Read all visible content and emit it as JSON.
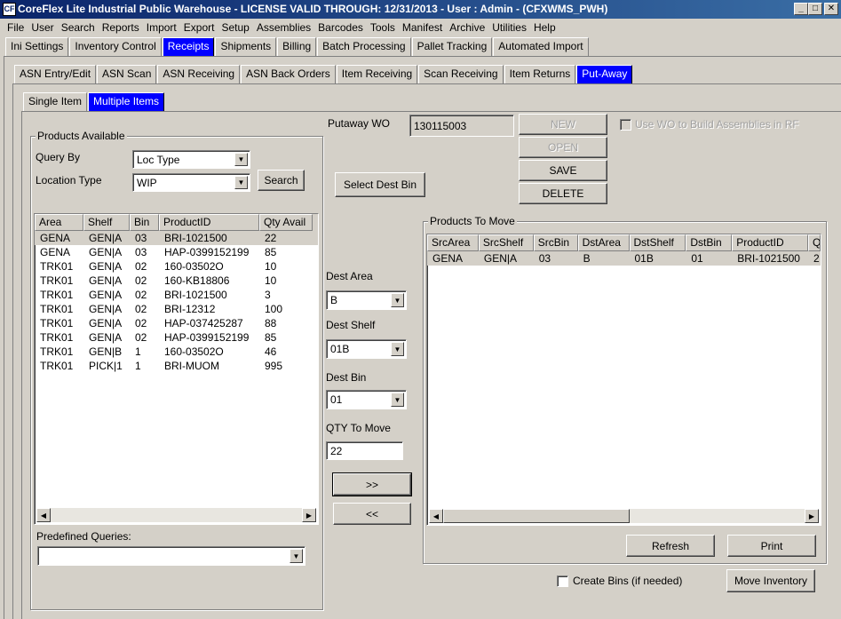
{
  "window": {
    "title": "CoreFlex Lite Industrial Public Warehouse - LICENSE VALID THROUGH: 12/31/2013 - User : Admin - (CFXWMS_PWH)",
    "minimize": "_",
    "maximize": "□",
    "close": "✕"
  },
  "menu": [
    "File",
    "User",
    "Search",
    "Reports",
    "Import",
    "Export",
    "Setup",
    "Assemblies",
    "Barcodes",
    "Tools",
    "Manifest",
    "Archive",
    "Utilities",
    "Help"
  ],
  "tabs1": [
    "Ini Settings",
    "Inventory Control",
    "Receipts",
    "Shipments",
    "Billing",
    "Batch Processing",
    "Pallet Tracking",
    "Automated Import"
  ],
  "tabs2": [
    "ASN Entry/Edit",
    "ASN Scan",
    "ASN Receiving",
    "ASN Back Orders",
    "Item Receiving",
    "Scan Receiving",
    "Item Returns",
    "Put-Away"
  ],
  "tabs3": [
    "Single Item",
    "Multiple Items"
  ],
  "products_available": {
    "title": "Products Available",
    "query_by_label": "Query By",
    "query_by_value": "Loc Type",
    "location_type_label": "Location Type",
    "location_type_value": "WIP",
    "search_button": "Search",
    "columns": [
      "Area",
      "Shelf",
      "Bin",
      "ProductID",
      "Qty Avail"
    ],
    "rows": [
      [
        "GENA",
        "GEN|A",
        "03",
        "BRI-1021500",
        "22"
      ],
      [
        "GENA",
        "GEN|A",
        "03",
        "HAP-0399152199",
        "85"
      ],
      [
        "TRK01",
        "GEN|A",
        "02",
        "160-03502O",
        "10"
      ],
      [
        "TRK01",
        "GEN|A",
        "02",
        "160-KB18806",
        "10"
      ],
      [
        "TRK01",
        "GEN|A",
        "02",
        "BRI-1021500",
        "3"
      ],
      [
        "TRK01",
        "GEN|A",
        "02",
        "BRI-12312",
        "100"
      ],
      [
        "TRK01",
        "GEN|A",
        "02",
        "HAP-037425287",
        "88"
      ],
      [
        "TRK01",
        "GEN|A",
        "02",
        "HAP-0399152199",
        "85"
      ],
      [
        "TRK01",
        "GEN|B",
        "1",
        "160-03502O",
        "46"
      ],
      [
        "TRK01",
        "PICK|1",
        "1",
        "BRI-MUOM",
        "995"
      ]
    ],
    "predefined_label": "Predefined Queries:",
    "predefined_value": ""
  },
  "putaway": {
    "label": "Putaway WO",
    "value": "130115003"
  },
  "buttons": {
    "new": "NEW",
    "open": "OPEN",
    "save": "SAVE",
    "delete": "DELETE",
    "select_dest_bin": "Select Dest Bin",
    "move_right": ">>",
    "move_left": "<<",
    "refresh": "Refresh",
    "print": "Print",
    "move_inventory": "Move Inventory"
  },
  "use_wo_label": "Use WO to Build Assemblies in RF",
  "dest": {
    "area_label": "Dest Area",
    "area_value": "B",
    "shelf_label": "Dest Shelf",
    "shelf_value": "01B",
    "bin_label": "Dest Bin",
    "bin_value": "01",
    "qty_label": "QTY To Move",
    "qty_value": "22"
  },
  "products_to_move": {
    "title": "Products To Move",
    "columns": [
      "SrcArea",
      "SrcShelf",
      "SrcBin",
      "DstArea",
      "DstShelf",
      "DstBin",
      "ProductID",
      "Q"
    ],
    "rows": [
      [
        "GENA",
        "GEN|A",
        "03",
        "B",
        "01B",
        "01",
        "BRI-1021500",
        "2"
      ]
    ]
  },
  "create_bins_label": "Create Bins (if needed)"
}
